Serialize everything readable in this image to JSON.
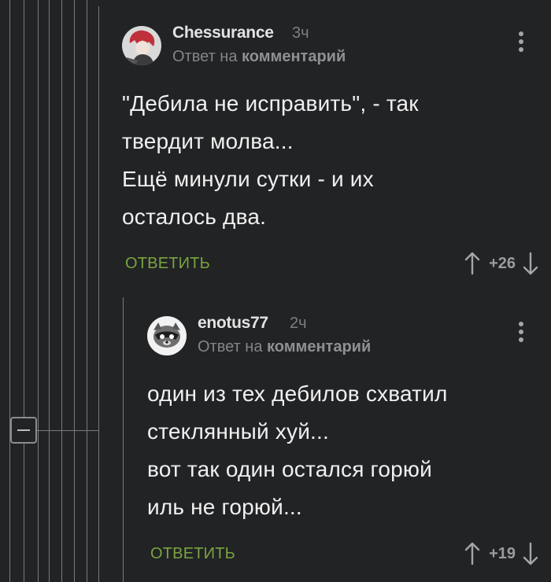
{
  "comments": [
    {
      "username": "Chessurance",
      "time": "3ч",
      "reply_prefix": "Ответ на",
      "reply_target": "комментарий",
      "lines": [
        "\"Дебила не исправить\", - так",
        "твердит молва...",
        "Ещё минули сутки - и их",
        "осталось два."
      ],
      "reply_label": "ОТВЕТИТЬ",
      "score": "+26",
      "avatar_icon": "avatar-red-hair"
    },
    {
      "username": "enotus77",
      "time": "2ч",
      "reply_prefix": "Ответ на",
      "reply_target": "комментарий",
      "lines": [
        "один из тех дебилов схватил",
        "стеклянный хуй...",
        "вот так один остался горюй",
        "иль не горюй..."
      ],
      "reply_label": "ОТВЕТИТЬ",
      "score": "+19",
      "avatar_icon": "avatar-raccoon"
    }
  ],
  "icons": {
    "upvote": "arrow-up-icon",
    "downvote": "arrow-down-icon",
    "more": "more-vertical-icon",
    "collapse": "minus-icon"
  },
  "colors": {
    "background": "#222325",
    "accent_green": "#79a440",
    "thread_line": "#7a7b7d"
  }
}
